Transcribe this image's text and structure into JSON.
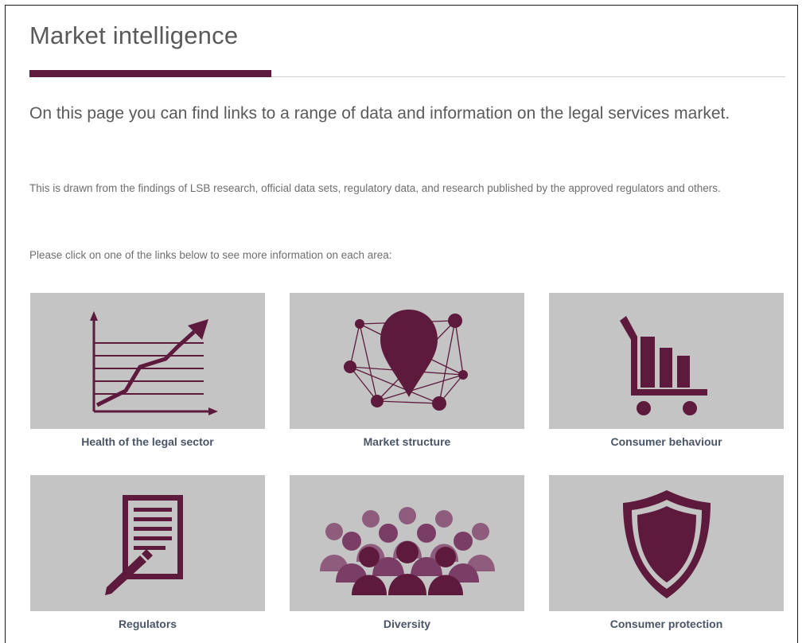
{
  "page": {
    "title": "Market intelligence",
    "intro": "On this page you can find links to a range of data and information on the legal services market.",
    "description": "This is drawn from the findings of LSB research, official data sets, regulatory data, and research published by the approved regulators and others.",
    "instruction": "Please click on one of the links below to see more information on each area:"
  },
  "colors": {
    "accent": "#5e1a3c",
    "tile_bg": "#c4c4c4",
    "label": "#4a5566"
  },
  "tiles": [
    {
      "label": "Health of the legal sector",
      "icon": "line-chart-icon"
    },
    {
      "label": "Market structure",
      "icon": "network-pin-icon"
    },
    {
      "label": "Consumer behaviour",
      "icon": "shopping-cart-icon"
    },
    {
      "label": "Regulators",
      "icon": "document-pen-icon"
    },
    {
      "label": "Diversity",
      "icon": "people-group-icon"
    },
    {
      "label": "Consumer protection",
      "icon": "shield-icon"
    }
  ]
}
